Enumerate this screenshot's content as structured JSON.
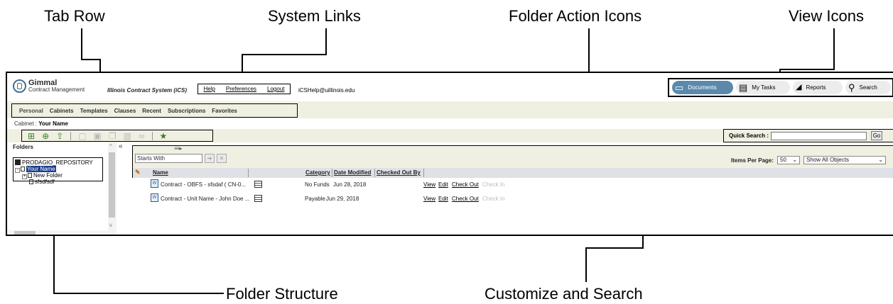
{
  "callouts": {
    "tab_row": "Tab Row",
    "system_links": "System Links",
    "folder_action_icons": "Folder Action Icons",
    "view_icons": "View Icons",
    "folder_structure": "Folder Structure",
    "customize_search": "Customize and Search"
  },
  "header": {
    "logo_main": "Gimmal",
    "logo_sub": "Contract Management",
    "system_title": "Illinois Contract System (iCS)",
    "links": {
      "help": "Help",
      "preferences": "Preferences",
      "logout": "Logout"
    },
    "email": "iCSHelp@uillinois.edu"
  },
  "views": [
    {
      "label": "Documents",
      "icon": "documents-icon",
      "active": true
    },
    {
      "label": "My Tasks",
      "icon": "clipboard-icon",
      "active": false
    },
    {
      "label": "Reports",
      "icon": "chart-icon",
      "active": false
    },
    {
      "label": "Search",
      "icon": "magnifier-icon",
      "active": false
    }
  ],
  "tabs": [
    "Personal",
    "Cabinets",
    "Templates",
    "Clauses",
    "Recent",
    "Subscriptions",
    "Favorites"
  ],
  "cabinet": {
    "label": "Cabinet :",
    "value": "Your Name"
  },
  "quick_search": {
    "label": "Quick Search :",
    "go": "Go"
  },
  "folders": {
    "header": "Folders",
    "collapse": "«",
    "repo": "PRODAGIO_REPOSITORY",
    "user": "Your Name",
    "children": [
      "New Folder",
      "sfsdfsdf"
    ]
  },
  "customize": {
    "filter_value": "Starts With",
    "items_per_page_label": "Items Per Page:",
    "items_per_page": "50",
    "show": "Show All Objects"
  },
  "table": {
    "columns": {
      "name": "Name",
      "category": "Category",
      "date": "Date Modified",
      "checked_out": "Checked Out By"
    },
    "rows": [
      {
        "name": "Contract - OBFS - sfsdaf ( CN-0...",
        "category": "No Funds",
        "date": "Jun 28, 2018",
        "actions": [
          "View",
          "Edit",
          "Check Out",
          "Check In"
        ]
      },
      {
        "name": "Contract - Unit Name - John Doe ...",
        "category": "Payable",
        "date": "Jun 29, 2018",
        "actions": [
          "View",
          "Edit",
          "Check Out",
          "Check In"
        ]
      }
    ]
  }
}
